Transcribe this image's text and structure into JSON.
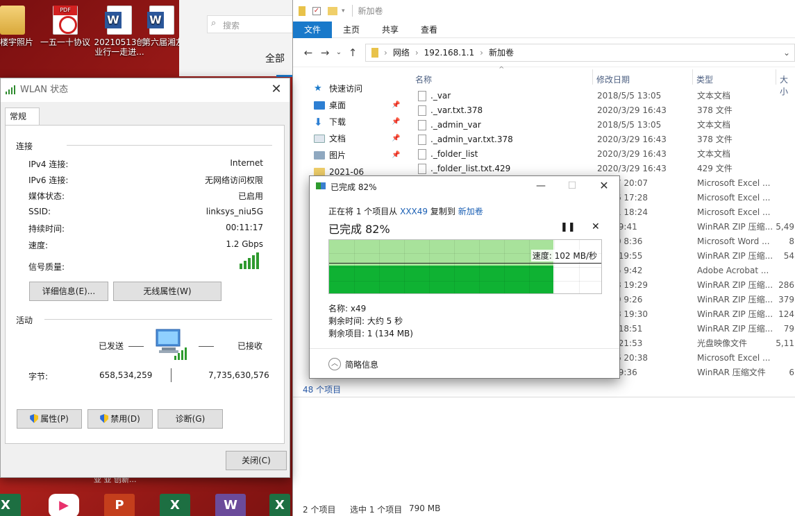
{
  "desktop": {
    "icons": [
      {
        "label": "福楼宇照片",
        "kind": "folder"
      },
      {
        "label": "一五一十协议",
        "kind": "pdf",
        "badge": "PDF"
      },
      {
        "label": "20210513创业行一走进...",
        "kind": "word"
      },
      {
        "label": "第六届湘友三创...",
        "kind": "word"
      }
    ],
    "taskbar_labels": [
      "X",
      "▶",
      "P",
      "X",
      "W",
      "X"
    ],
    "under_label": "亚 亚 创新..."
  },
  "search_strip": {
    "placeholder": "搜索",
    "heading": "全部"
  },
  "wlan": {
    "title": "WLAN 状态",
    "tab": "常规",
    "sections": {
      "connection": "连接",
      "activity": "活动"
    },
    "rows": [
      {
        "label": "IPv4 连接:",
        "value": "Internet"
      },
      {
        "label": "IPv6 连接:",
        "value": "无网络访问权限"
      },
      {
        "label": "媒体状态:",
        "value": "已启用"
      },
      {
        "label": "SSID:",
        "value": "linksys_niu5G"
      },
      {
        "label": "持续时间:",
        "value": "00:11:17"
      },
      {
        "label": "速度:",
        "value": "1.2 Gbps"
      }
    ],
    "signal_label": "信号质量:",
    "signal_bars": 5,
    "buttons": {
      "details": "详细信息(E)...",
      "wireless_props": "无线属性(W)",
      "properties": "属性(P)",
      "disable": "禁用(D)",
      "diagnose": "诊断(G)",
      "close": "关闭(C)"
    },
    "activity": {
      "sent_label": "已发送",
      "received_label": "已接收",
      "bytes_label": "字节:",
      "sent": "658,534,259",
      "received": "7,735,630,576"
    }
  },
  "explorer": {
    "title": "新加卷",
    "ribbon": [
      "文件",
      "主页",
      "共享",
      "查看"
    ],
    "path": [
      "网络",
      "192.168.1.1",
      "新加卷"
    ],
    "nav": [
      {
        "label": "快速访问",
        "pinned": false
      },
      {
        "label": "桌面",
        "pinned": true
      },
      {
        "label": "下载",
        "pinned": true
      },
      {
        "label": "文档",
        "pinned": true
      },
      {
        "label": "图片",
        "pinned": true
      },
      {
        "label": "2021-06",
        "pinned": false
      }
    ],
    "columns": {
      "name": "名称",
      "date": "修改日期",
      "type": "类型",
      "size": "大小"
    },
    "files": [
      {
        "name": "._var",
        "date": "2018/5/5 13:05",
        "type": "文本文档",
        "size": ""
      },
      {
        "name": "._var.txt.378",
        "date": "2020/3/29 16:43",
        "type": "378 文件",
        "size": ""
      },
      {
        "name": "._admin_var",
        "date": "2018/5/5 13:05",
        "type": "文本文档",
        "size": ""
      },
      {
        "name": "._admin_var.txt.378",
        "date": "2020/3/29 16:43",
        "type": "378 文件",
        "size": ""
      },
      {
        "name": "._folder_list",
        "date": "2020/3/29 16:43",
        "type": "文本文档",
        "size": ""
      },
      {
        "name": "._folder_list.txt.429",
        "date": "2020/3/29 16:43",
        "type": "429 文件",
        "size": ""
      },
      {
        "name": "",
        "date": "12/27 20:07",
        "type": "Microsoft Excel ...",
        "size": ""
      },
      {
        "name": "",
        "date": "12/16 17:28",
        "type": "Microsoft Excel ...",
        "size": ""
      },
      {
        "name": "",
        "date": "12/31 18:24",
        "type": "Microsoft Excel ...",
        "size": ""
      },
      {
        "name": "",
        "date": "1/18 9:41",
        "type": "WinRAR ZIP 压缩...",
        "size": "5,49"
      },
      {
        "name": "",
        "date": "11/10 8:36",
        "type": "Microsoft Word ...",
        "size": "8"
      },
      {
        "name": "",
        "date": "10/1 19:55",
        "type": "WinRAR ZIP 压缩...",
        "size": "54"
      },
      {
        "name": "",
        "date": "10/25 9:42",
        "type": "Adobe Acrobat ...",
        "size": ""
      },
      {
        "name": "",
        "date": "10/28 19:29",
        "type": "WinRAR ZIP 压缩...",
        "size": "286"
      },
      {
        "name": "",
        "date": "10/29 9:26",
        "type": "WinRAR ZIP 压缩...",
        "size": "379"
      },
      {
        "name": "",
        "date": "10/28 19:30",
        "type": "WinRAR ZIP 压缩...",
        "size": "124"
      },
      {
        "name": "",
        "date": "10/6 18:51",
        "type": "WinRAR ZIP 压缩...",
        "size": "79"
      },
      {
        "name": "",
        "date": "11/8 21:53",
        "type": "光盘映像文件",
        "size": "5,11"
      },
      {
        "name": "",
        "date": "12/16 20:38",
        "type": "Microsoft Excel ...",
        "size": ""
      },
      {
        "name": "",
        "date": "9/30 9:36",
        "type": "WinRAR 压缩文件",
        "size": "6"
      }
    ],
    "item_count": "48 个项目",
    "status": {
      "count": "2 个项目",
      "selected": "选中 1 个项目",
      "size": "790 MB"
    }
  },
  "copy": {
    "title": "已完成 82%",
    "progress": 82,
    "line_prefix": "正在将 1 个项目从",
    "source": "XXX49",
    "mid": "复制到",
    "dest": "新加卷",
    "heading": "已完成 82%",
    "speed": "速度: 102 MB/秒",
    "name": "名称: x49",
    "remaining_time": "剩余时间: 大约 5 秒",
    "remaining_items": "剩余项目: 1 (134 MB)",
    "less": "简略信息"
  },
  "colors": {
    "accent": "#1979ca",
    "graph_light": "#a8e29b",
    "graph_dark": "#0fb233",
    "link": "#1a5fb4"
  }
}
